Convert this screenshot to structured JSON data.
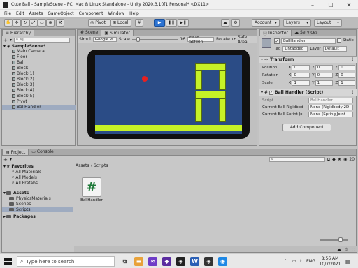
{
  "window": {
    "title": "Cute Ball - SampleScene - PC, Mac & Linux Standalone - Unity 2020.3.10f1 Personal* <DX11>"
  },
  "window_controls": {
    "minimize": "–",
    "maximize": "☐",
    "close": "✕"
  },
  "menu": [
    "File",
    "Edit",
    "Assets",
    "GameObject",
    "Component",
    "Window",
    "Help"
  ],
  "toolbar": {
    "pivot": "Pivot",
    "local": "Local",
    "account": "Account",
    "layers": "Layers",
    "layout": "Layout"
  },
  "hierarchy": {
    "tab": "Hierarchy",
    "add": "+",
    "search_placeholder": "All",
    "scene": "SampleScene*",
    "items": [
      "Main Camera",
      "Floor",
      "Ball",
      "Block",
      "Block(1)",
      "Block(2)",
      "Block(3)",
      "Block(4)",
      "Block(5)",
      "Pivot",
      "BallHandler"
    ]
  },
  "scene_view": {
    "tabs": [
      "Scene",
      "Simulator"
    ],
    "sim_label": "Simul",
    "device": "Google Pi",
    "scale_label": "Scale",
    "scale_value": "16",
    "fit_button": "Fit to Screen",
    "rotate": "Rotate",
    "safe_area": "Safe Area"
  },
  "inspector": {
    "tabs": [
      "Inspector",
      "Services"
    ],
    "object_name": "BallHandler",
    "static_label": "Static",
    "tag_label": "Tag",
    "tag_value": "Untagged",
    "layer_label": "Layer",
    "layer_value": "Default",
    "transform_title": "Transform",
    "position": {
      "label": "Position",
      "x": "0",
      "y": "0",
      "z": "0"
    },
    "rotation": {
      "label": "Rotation",
      "x": "0",
      "y": "0",
      "z": "0"
    },
    "scale": {
      "label": "Scale",
      "x": "1",
      "y": "1",
      "z": "1"
    },
    "script_component_title": "Ball Handler (Script)",
    "script_label": "Script",
    "script_value": "BallHandler",
    "rigidbody_label": "Current Ball Rigidbod",
    "rigidbody_value": "None (Rigidbody 2D",
    "spring_label": "Current Ball Sprint Jo",
    "spring_value": "None (Spring Joint",
    "add_component": "Add Component"
  },
  "project": {
    "tabs": [
      "Project",
      "Console"
    ],
    "add": "+",
    "hidden_count": "20",
    "favorites_title": "Favorites",
    "favorites": [
      "All Materials",
      "All Models",
      "All Prefabs"
    ],
    "assets_title": "Assets",
    "assets": [
      "PhysicsMaterials",
      "Scenes",
      "Scripts"
    ],
    "packages_title": "Packages",
    "breadcrumb": [
      "Assets",
      "Scripts"
    ],
    "file_name": "BallHandler",
    "file_icon": "#"
  },
  "taskbar": {
    "search_placeholder": "Type here to search",
    "time": "8:56 AM",
    "date": "10/7/2021",
    "lang": "ENG"
  },
  "colors": {
    "game_background": "#2b4c86",
    "ball": "#e82020",
    "blocks": "#c6f227",
    "device_frame": "#111111",
    "play_button": "#2c73d2"
  }
}
